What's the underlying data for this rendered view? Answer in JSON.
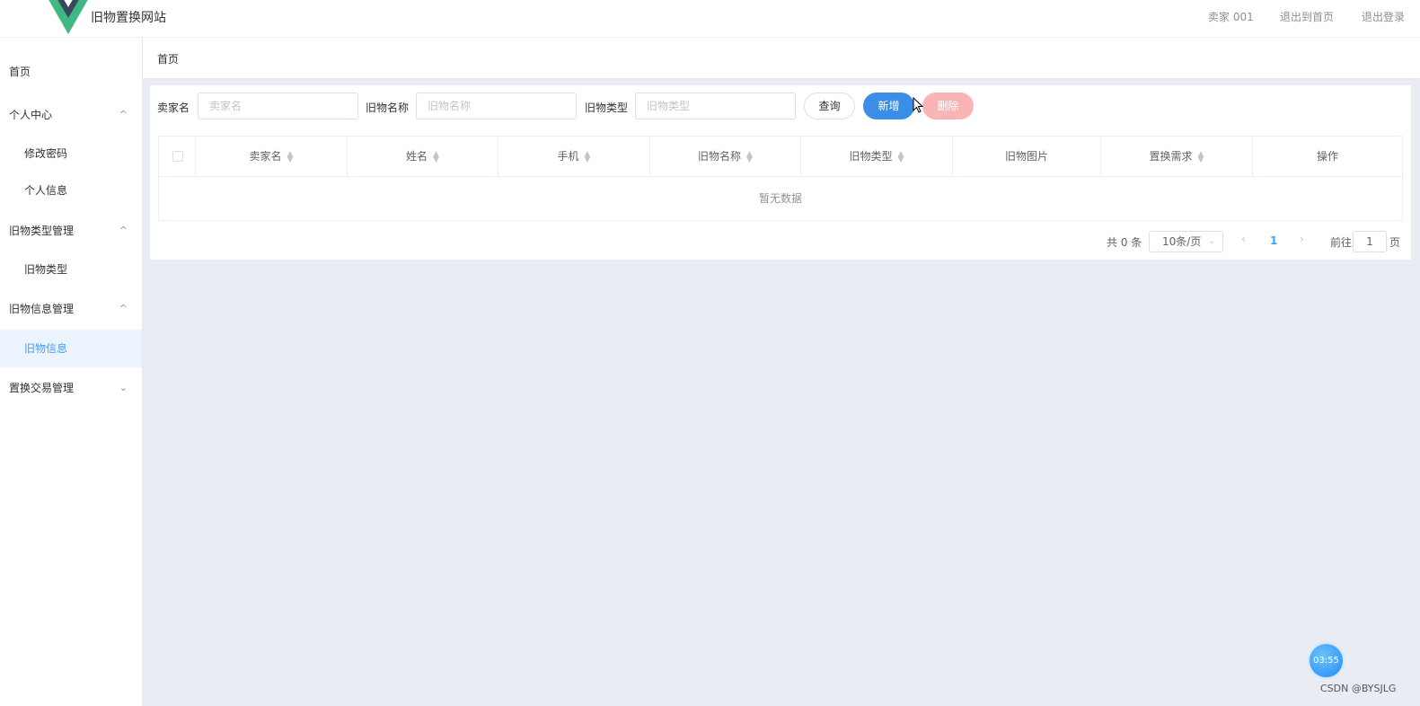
{
  "header": {
    "site_title": "旧物置换网站",
    "user_label": "卖家 001",
    "back_home": "退出到首页",
    "logout": "退出登录",
    "logo_colors": {
      "outer": "#41b883",
      "inner": "#35495e"
    }
  },
  "sidebar": {
    "items": [
      {
        "label": "首页",
        "type": "top"
      },
      {
        "label": "个人中心",
        "type": "group",
        "chevron": "^"
      },
      {
        "label": "修改密码",
        "type": "sub"
      },
      {
        "label": "个人信息",
        "type": "sub"
      },
      {
        "label": "旧物类型管理",
        "type": "group",
        "chevron": "^"
      },
      {
        "label": "旧物类型",
        "type": "sub"
      },
      {
        "label": "旧物信息管理",
        "type": "group",
        "chevron": "^"
      },
      {
        "label": "旧物信息",
        "type": "sub",
        "active": true
      },
      {
        "label": "置换交易管理",
        "type": "group",
        "chevron": "⌄"
      }
    ]
  },
  "breadcrumb": "首页",
  "search": {
    "seller_label": "卖家名",
    "seller_placeholder": "卖家名",
    "item_name_label": "旧物名称",
    "item_name_placeholder": "旧物名称",
    "item_type_label": "旧物类型",
    "item_type_placeholder": "旧物类型",
    "query_btn": "查询",
    "add_btn": "新增",
    "delete_btn": "删除"
  },
  "table": {
    "columns": [
      "卖家名",
      "姓名",
      "手机",
      "旧物名称",
      "旧物类型",
      "旧物图片",
      "置换需求",
      "操作"
    ],
    "sortable": [
      true,
      true,
      true,
      true,
      true,
      false,
      true,
      false
    ],
    "empty_text": "暂无数据"
  },
  "pagination": {
    "total_text": "共 0 条",
    "page_size": "10条/页",
    "current_page": "1",
    "goto_label": "前往",
    "goto_value": "1",
    "page_unit": "页"
  },
  "overlay": {
    "timer": "03:55",
    "watermark": "CSDN @BYSJLG"
  },
  "colors": {
    "primary": "#3a8ee6",
    "danger_disabled": "#f9b5b5",
    "active_menu_bg": "#ecf5ff",
    "active_menu_text": "#409eff"
  }
}
